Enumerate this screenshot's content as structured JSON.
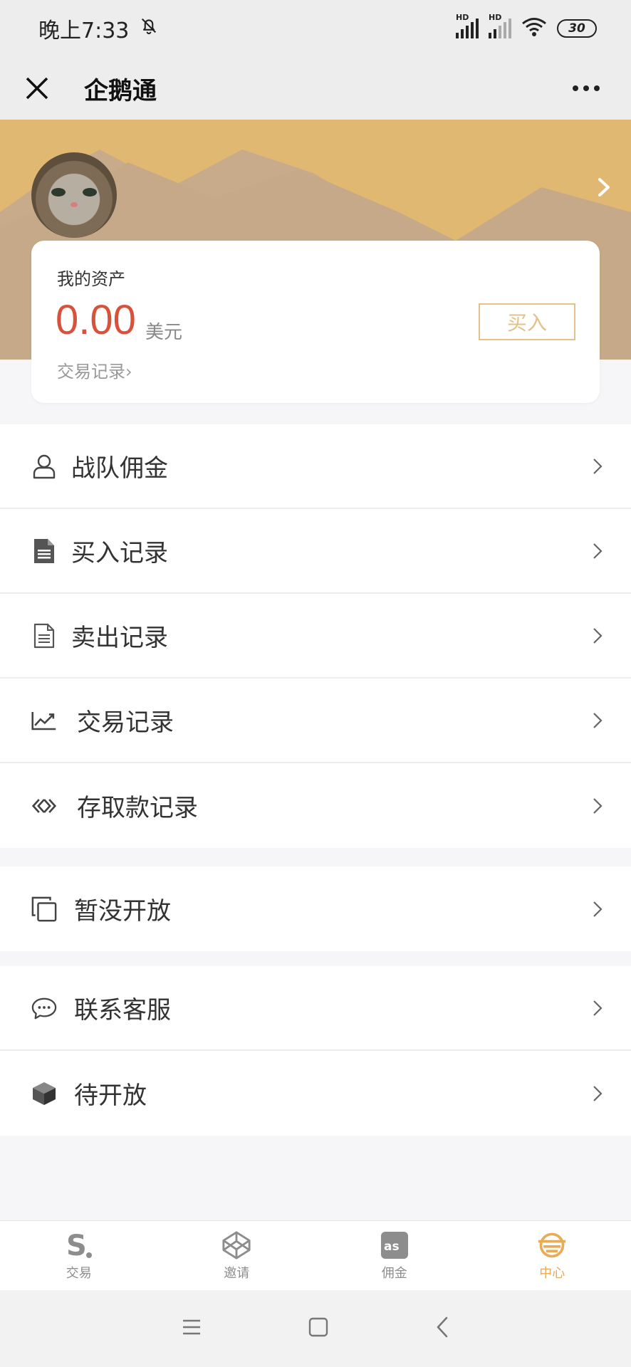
{
  "status_bar": {
    "time": "晚上7:33",
    "hd1": "HD",
    "hd2": "HD",
    "battery": "30"
  },
  "nav": {
    "title": "企鹅通"
  },
  "asset_card": {
    "label": "我的资产",
    "value": "0.00",
    "unit": "美元",
    "records_link": "交易记录›",
    "buy_label": "买入"
  },
  "menu_group_1": [
    {
      "label": "战队佣金",
      "icon": "user-icon"
    },
    {
      "label": "买入记录",
      "icon": "document-filled-icon"
    },
    {
      "label": "卖出记录",
      "icon": "document-outline-icon"
    },
    {
      "label": "交易记录",
      "icon": "chart-line-icon"
    },
    {
      "label": "存取款记录",
      "icon": "transfer-icon"
    }
  ],
  "menu_group_2": [
    {
      "label": "暂没开放",
      "icon": "copy-icon"
    }
  ],
  "menu_group_3": [
    {
      "label": "联系客服",
      "icon": "chat-icon"
    },
    {
      "label": "待开放",
      "icon": "cube-icon"
    }
  ],
  "tabs": [
    {
      "label": "交易",
      "icon": "s-logo-icon",
      "active": false
    },
    {
      "label": "邀请",
      "icon": "codepen-icon",
      "active": false
    },
    {
      "label": "佣金",
      "icon": "lastfm-icon",
      "active": false
    },
    {
      "label": "中心",
      "icon": "center-icon",
      "active": true
    }
  ],
  "colors": {
    "accent": "#e9ab55",
    "hero_bg": "#e0b872",
    "mountain": "#c8ab8a",
    "asset_value": "#d9513a",
    "buy_border": "#e3c28a"
  }
}
